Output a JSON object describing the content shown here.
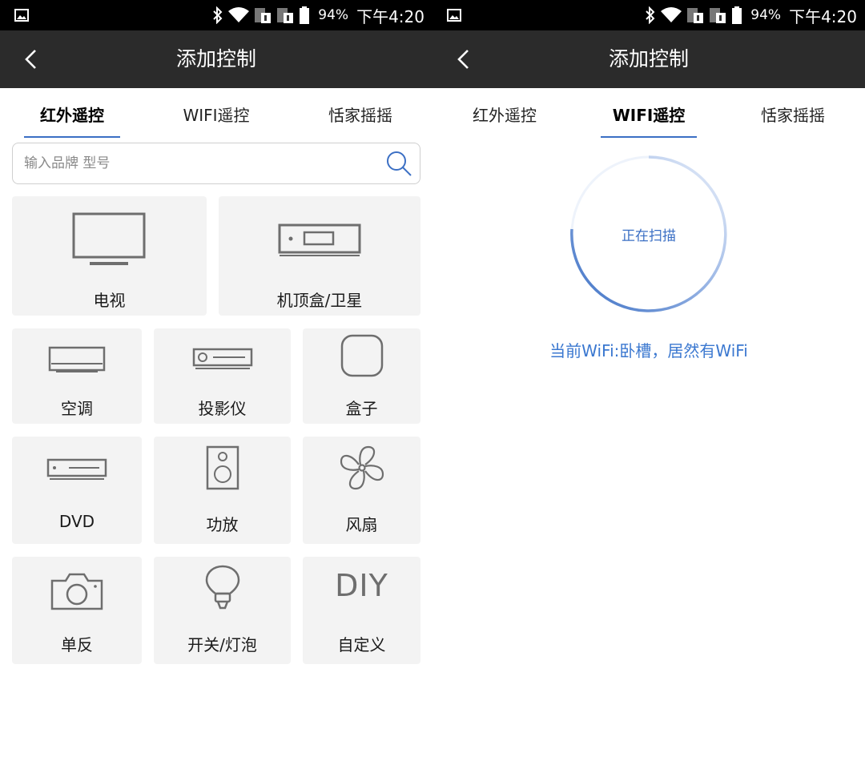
{
  "status_bar": {
    "battery_percent": "94%",
    "time": "下午4:20"
  },
  "app_bar": {
    "title": "添加控制"
  },
  "tabs": [
    "红外遥控",
    "WIFI遥控",
    "恬家摇摇"
  ],
  "left_screen": {
    "active_tab": 0,
    "search": {
      "placeholder": "输入品牌 型号",
      "value": ""
    },
    "devices": [
      {
        "label": "电视",
        "icon": "tv-icon"
      },
      {
        "label": "机顶盒/卫星",
        "icon": "settop-box-icon"
      },
      {
        "label": "空调",
        "icon": "air-conditioner-icon"
      },
      {
        "label": "投影仪",
        "icon": "projector-icon"
      },
      {
        "label": "盒子",
        "icon": "box-icon"
      },
      {
        "label": "DVD",
        "icon": "dvd-icon"
      },
      {
        "label": "功放",
        "icon": "speaker-icon"
      },
      {
        "label": "风扇",
        "icon": "fan-icon"
      },
      {
        "label": "单反",
        "icon": "camera-icon"
      },
      {
        "label": "开关/灯泡",
        "icon": "bulb-icon"
      },
      {
        "label": "自定义",
        "icon": "diy-icon",
        "icon_text": "DIY"
      }
    ]
  },
  "right_screen": {
    "active_tab": 1,
    "scan_text": "正在扫描",
    "wifi_status": "当前WiFi:卧槽，居然有WiFi"
  },
  "colors": {
    "accent": "#3b6fc4",
    "appbar": "#2b2b2b",
    "statusbar": "#000000",
    "tile_bg": "#f3f3f3",
    "icon_stroke": "#6e6e6e"
  }
}
